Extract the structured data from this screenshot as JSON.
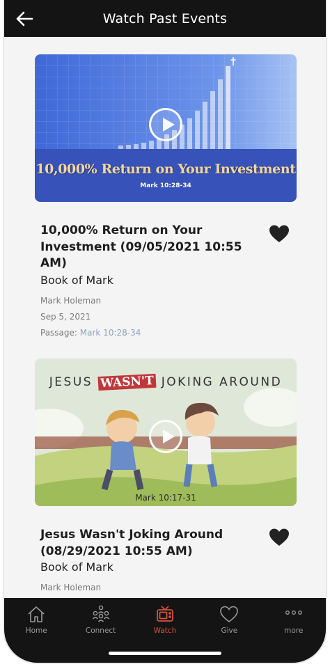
{
  "header": {
    "title": "Watch Past Events",
    "back_icon": "arrow-left-icon"
  },
  "events": [
    {
      "thumb_title": "10,000% Return on Your Investment",
      "thumb_passage": "Mark 10:28-34",
      "title": "10,000% Return on Your Investment (09/05/2021 10:55 AM)",
      "series": "Book of Mark",
      "speaker": "Mark Holeman",
      "date": "Sep 5, 2021",
      "passage_label": "Passage:",
      "passage": "Mark 10:28-34",
      "favorited": true
    },
    {
      "thumb_heading_pre": "JESUS ",
      "thumb_heading_emph": "WASN'T",
      "thumb_heading_post": " JOKING AROUND",
      "thumb_passage": "Mark 10:17-31",
      "title": "Jesus Wasn't Joking Around (08/29/2021 10:55 AM)",
      "series": "Book of Mark",
      "speaker": "Mark Holeman",
      "favorited": true
    }
  ],
  "tabbar": {
    "active": "Watch",
    "tabs": [
      {
        "label": "Home",
        "icon": "home-icon"
      },
      {
        "label": "Connect",
        "icon": "people-icon"
      },
      {
        "label": "Watch",
        "icon": "tv-icon"
      },
      {
        "label": "Give",
        "icon": "heart-outline-icon"
      },
      {
        "label": "more",
        "icon": "more-dots-icon"
      }
    ]
  },
  "colors": {
    "header_bg": "#141414",
    "accent": "#d5533f",
    "link": "#8aa3bf"
  }
}
